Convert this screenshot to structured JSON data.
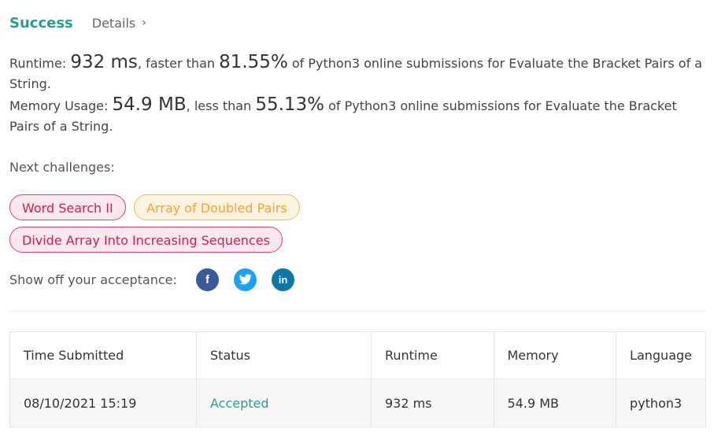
{
  "header": {
    "status": "Success",
    "details_link": "Details",
    "details_chevron": "›"
  },
  "runtime_line": {
    "label": "Runtime: ",
    "value": "932 ms",
    "mid": ", faster than ",
    "percent": "81.55%",
    "suffix": " of Python3 online submissions for Evaluate the Bracket Pairs of a String."
  },
  "memory_line": {
    "label": "Memory Usage: ",
    "value": "54.9 MB",
    "mid": ", less than ",
    "percent": "55.13%",
    "suffix": " of Python3 online submissions for Evaluate the Bracket Pairs of a String."
  },
  "next_challenges": {
    "label": "Next challenges:",
    "items": [
      {
        "label": "Word Search II",
        "difficulty_color": "#c7254e"
      },
      {
        "label": "Array of Doubled Pairs",
        "difficulty_color": "#f0a432"
      },
      {
        "label": "Divide Array Into Increasing Sequences",
        "difficulty_color": "#c7254e"
      }
    ]
  },
  "share": {
    "label": "Show off your acceptance:",
    "icons": [
      "facebook-icon",
      "twitter-icon",
      "linkedin-icon"
    ]
  },
  "submissions_table": {
    "headers": [
      "Time Submitted",
      "Status",
      "Runtime",
      "Memory",
      "Language"
    ],
    "rows": [
      [
        "08/10/2021 15:19",
        "Accepted",
        "932 ms",
        "54.9 MB",
        "python3"
      ]
    ]
  },
  "colors": {
    "accent": "#2a9d8f",
    "hard": "#c7254e",
    "medium": "#f0a432"
  }
}
